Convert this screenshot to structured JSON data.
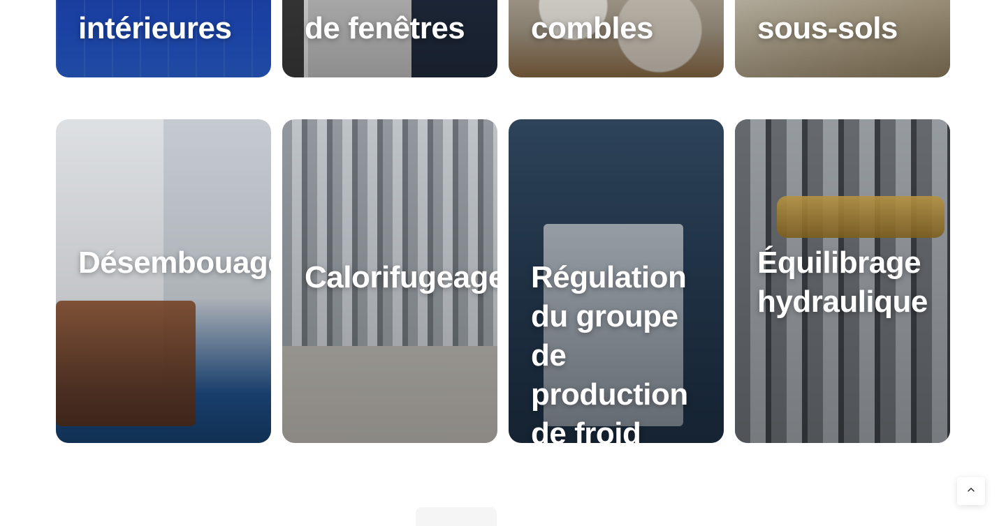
{
  "cards_top": [
    {
      "title": "intérieures"
    },
    {
      "title": "de fenêtres"
    },
    {
      "title": "combles"
    },
    {
      "title": "sous-sols"
    }
  ],
  "cards_bottom": [
    {
      "title": "Désembouage"
    },
    {
      "title": "Calorifugeage"
    },
    {
      "title": "Régulation du groupe de production de froid"
    },
    {
      "title": "Équilibrage hydraulique"
    }
  ],
  "scroll_top": {
    "icon": "chevron-up-icon"
  }
}
